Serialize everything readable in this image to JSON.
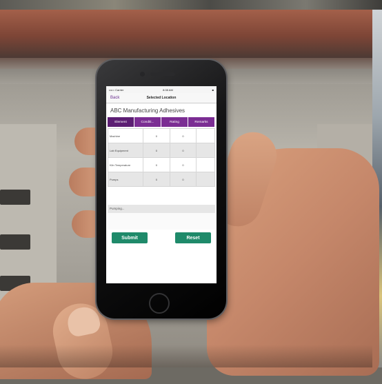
{
  "status_bar": {
    "carrier": "••••○ Carrier",
    "time": "8:08 AM",
    "battery": "■"
  },
  "nav": {
    "back_label": "Back",
    "title": "Selected Location"
  },
  "company_name": "ABC Manufacturing Adhesives",
  "tabs": [
    {
      "label": "Element",
      "active": true
    },
    {
      "label": "Conditi...",
      "active": false
    },
    {
      "label": "Rating",
      "active": false
    },
    {
      "label": "Remarks",
      "active": false
    }
  ],
  "grid_rows": [
    {
      "label": "Machine",
      "col2": "0",
      "col3": "0"
    },
    {
      "label": "Lab Equipment",
      "col2": "0",
      "col3": "0"
    },
    {
      "label": "Kiln Temperature",
      "col2": "0",
      "col3": "0"
    },
    {
      "label": "Pumps",
      "col2": "0",
      "col3": "0"
    }
  ],
  "remarks_label": "Pumping...",
  "actions": {
    "submit_label": "Submit",
    "reset_label": "Reset"
  },
  "colors": {
    "tab_purple": "#7b2d93",
    "button_green": "#1f8a6a"
  },
  "icons": [
    "signal-icon",
    "battery-icon",
    "home-button-icon"
  ]
}
